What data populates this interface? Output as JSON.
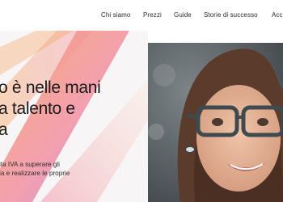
{
  "nav": {
    "items": [
      {
        "label": "Chi siamo"
      },
      {
        "label": "Prezzi"
      },
      {
        "label": "Guide"
      },
      {
        "label": "Storie di successo"
      },
      {
        "label": "Acce"
      }
    ]
  },
  "hero": {
    "headline_lines": [
      "o è nelle mani",
      "a talento e",
      "a"
    ],
    "subtext_lines": [
      "ita IVA a superare gli",
      "ia e realizzare le proprie"
    ],
    "colors": {
      "background": "#f7f5f5",
      "stripe_pink": "#f28aa0",
      "stripe_orange": "#f6a15b",
      "stripe_purple": "#9a6fd1"
    },
    "photo_icon": "woman-with-glasses-photo"
  }
}
